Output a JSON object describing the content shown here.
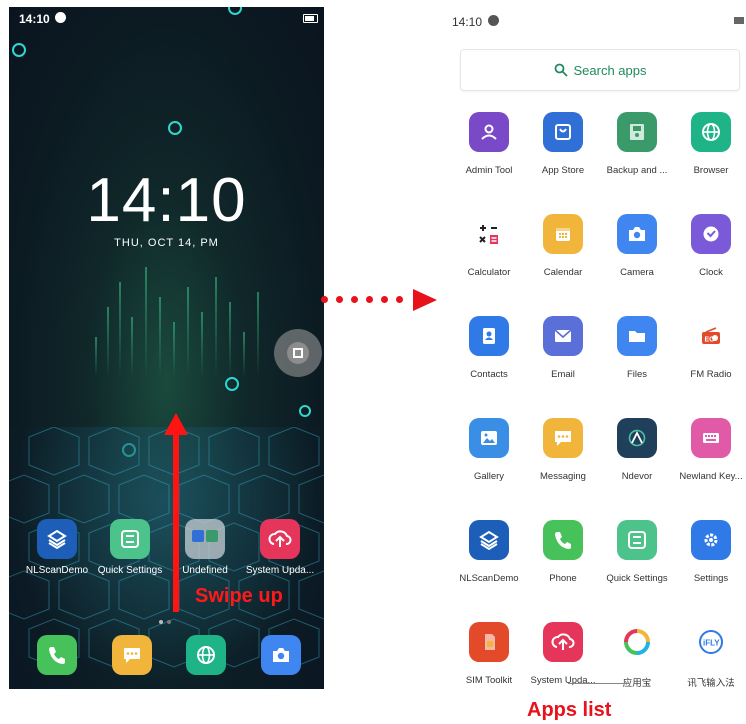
{
  "home_screen": {
    "status_time": "14:10",
    "clock": "14:10",
    "date": "THU, OCT 14, PM",
    "apps": [
      {
        "label": "NLScanDemo",
        "icon": "nlscan-icon",
        "color": "#1d5fb8"
      },
      {
        "label": "Quick Settings",
        "icon": "quick-settings-icon",
        "color": "#4cc38a"
      },
      {
        "label": "Undefined",
        "icon": "folder-icon",
        "color": "#c8d0d6"
      },
      {
        "label": "System Upda...",
        "icon": "cloud-upload-icon",
        "color": "#e6355a"
      }
    ],
    "dock": [
      {
        "icon": "phone-icon",
        "color": "#47c15a"
      },
      {
        "icon": "messaging-icon",
        "color": "#f0b53a"
      },
      {
        "icon": "browser-icon",
        "color": "#1fb388"
      },
      {
        "icon": "camera-icon",
        "color": "#3f86f0"
      }
    ],
    "swipe_label": "Swipe up"
  },
  "apps_screen": {
    "status_time": "14:10",
    "search_placeholder": "Search apps",
    "apps": [
      {
        "label": "Admin Tool",
        "icon": "admin-tool-icon",
        "color": "#7a49c8"
      },
      {
        "label": "App Store",
        "icon": "app-store-icon",
        "color": "#2f6fd6"
      },
      {
        "label": "Backup and ...",
        "icon": "backup-icon",
        "color": "#3a9a6a"
      },
      {
        "label": "Browser",
        "icon": "browser-icon",
        "color": "#1fb388"
      },
      {
        "label": "Calculator",
        "icon": "calculator-icon",
        "color": "#ffffff"
      },
      {
        "label": "Calendar",
        "icon": "calendar-icon",
        "color": "#f0b53a"
      },
      {
        "label": "Camera",
        "icon": "camera-icon",
        "color": "#3f86f0"
      },
      {
        "label": "Clock",
        "icon": "clock-icon",
        "color": "#7a5ad8"
      },
      {
        "label": "Contacts",
        "icon": "contacts-icon",
        "color": "#2f7ae6"
      },
      {
        "label": "Email",
        "icon": "email-icon",
        "color": "#5b6fd8"
      },
      {
        "label": "Files",
        "icon": "files-icon",
        "color": "#3f86f0"
      },
      {
        "label": "FM Radio",
        "icon": "fm-radio-icon",
        "color": "#ffffff"
      },
      {
        "label": "Gallery",
        "icon": "gallery-icon",
        "color": "#3a8ee6"
      },
      {
        "label": "Messaging",
        "icon": "messaging-icon",
        "color": "#f0b53a"
      },
      {
        "label": "Ndevor",
        "icon": "ndevor-icon",
        "color": "#1f3f5a"
      },
      {
        "label": "Newland Key...",
        "icon": "keyboard-icon",
        "color": "#e05aa8"
      },
      {
        "label": "NLScanDemo",
        "icon": "nlscan-icon",
        "color": "#1d5fb8"
      },
      {
        "label": "Phone",
        "icon": "phone-icon",
        "color": "#47c15a"
      },
      {
        "label": "Quick Settings",
        "icon": "quick-settings-icon",
        "color": "#4cc38a"
      },
      {
        "label": "Settings",
        "icon": "settings-icon",
        "color": "#2f7ae6"
      },
      {
        "label": "SIM Toolkit",
        "icon": "sim-toolkit-icon",
        "color": "#e24a2a"
      },
      {
        "label": "System Upda...",
        "icon": "cloud-upload-icon",
        "color": "#e6355a"
      },
      {
        "label": "应用宝",
        "icon": "yingyongbao-icon",
        "color": "#ffffff"
      },
      {
        "label": "讯飞输入法",
        "icon": "ifly-icon",
        "color": "#ffffff"
      }
    ],
    "caption": "Apps list"
  }
}
